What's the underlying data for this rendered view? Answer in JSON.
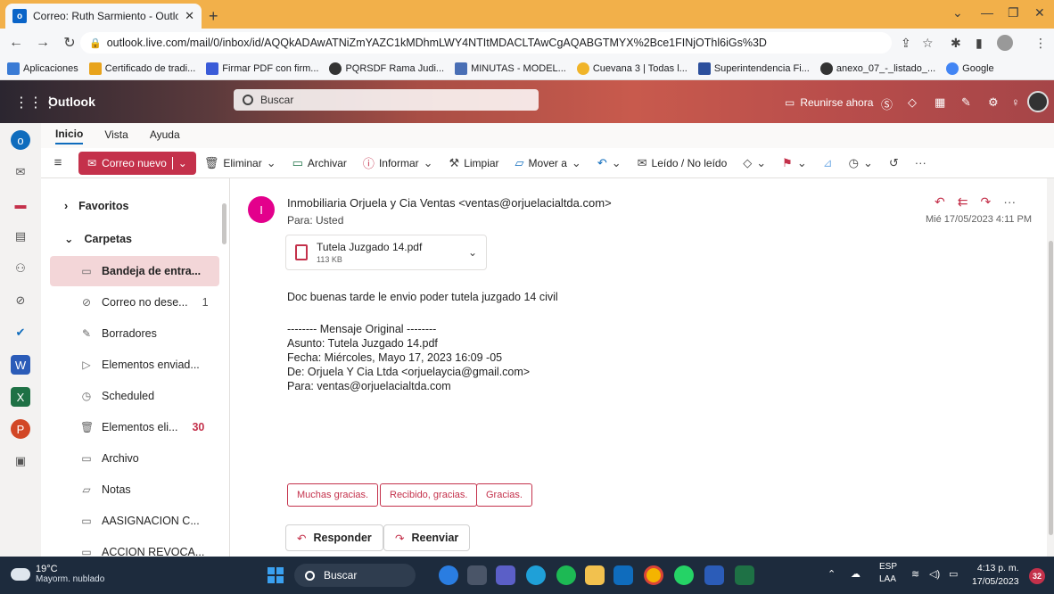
{
  "browser": {
    "tab_title": "Correo: Ruth Sarmiento - Outloo",
    "favicon_letter": "o",
    "url": "outlook.live.com/mail/0/inbox/id/AQQkADAwATNiZmYAZC1kMDhmLWY4NTItMDACLTAwCgAQABGTMYX%2Bce1FINjOThl6iGs%3D"
  },
  "bookmarks": [
    {
      "label": "Aplicaciones",
      "color": "#3a7bd5"
    },
    {
      "label": "Certificado de tradi...",
      "color": "#e8a31c"
    },
    {
      "label": "Firmar PDF con firm...",
      "color": "#3a5bd8"
    },
    {
      "label": "PQRSDF Rama Judi...",
      "color": "#333333"
    },
    {
      "label": "MINUTAS - MODEL...",
      "color": "#4a6fb5"
    },
    {
      "label": "Cuevana 3 | Todas l...",
      "color": "#f0b429"
    },
    {
      "label": "Superintendencia Fi...",
      "color": "#2c4f9c"
    },
    {
      "label": "anexo_07_-_listado_...",
      "color": "#333333"
    },
    {
      "label": "Google",
      "color": "#4285f4"
    }
  ],
  "outlook": {
    "brand": "Outlook",
    "search_placeholder": "Buscar",
    "meet_now": "Reunirse ahora"
  },
  "ribbon": {
    "tabs": [
      "Inicio",
      "Vista",
      "Ayuda"
    ],
    "new_mail": "Correo nuevo",
    "buttons": [
      "Eliminar",
      "Archivar",
      "Informar",
      "Limpiar",
      "Mover a",
      "Leído / No leído"
    ]
  },
  "folders": {
    "favorites": "Favoritos",
    "folders_header": "Carpetas",
    "items": [
      {
        "label": "Bandeja de entra...",
        "count": ""
      },
      {
        "label": "Correo no dese...",
        "count": "1"
      },
      {
        "label": "Borradores",
        "count": ""
      },
      {
        "label": "Elementos enviad...",
        "count": ""
      },
      {
        "label": "Scheduled",
        "count": ""
      },
      {
        "label": "Elementos eli...",
        "count": "30"
      },
      {
        "label": "Archivo",
        "count": ""
      },
      {
        "label": "Notas",
        "count": ""
      },
      {
        "label": "AASIGNACION C...",
        "count": ""
      },
      {
        "label": "ACCION REVOCA...",
        "count": ""
      }
    ]
  },
  "message": {
    "avatar_letter": "I",
    "sender": "Inmobiliaria Orjuela y Cia Ventas <ventas@orjuelacialtda.com>",
    "to": "Para: Usted",
    "date": "Mié 17/05/2023 4:11 PM",
    "attachment_name": "Tutela Juzgado 14.pdf",
    "attachment_size": "113 KB",
    "body_main": "Doc buenas tarde le envio poder tutela juzgado 14 civil",
    "original_header": "-------- Mensaje Original --------",
    "subject_line": "Asunto: Tutela Juzgado 14.pdf",
    "date_line": "Fecha: Miércoles, Mayo 17, 2023 16:09 -05",
    "from_line": "De: Orjuela Y Cia Ltda <orjuelaycia@gmail.com>",
    "to_line": "Para: ventas@orjuelacialtda.com",
    "quick_replies": [
      "Muchas gracias.",
      "Recibido, gracias.",
      "Gracias."
    ],
    "reply": "Responder",
    "forward": "Reenviar"
  },
  "taskbar": {
    "temperature": "19°C",
    "weather": "Mayorm. nublado",
    "search": "Buscar",
    "lang_top": "ESP",
    "lang_bottom": "LAA",
    "time": "4:13 p. m.",
    "date": "17/05/2023",
    "notifications": "32"
  },
  "colors": {
    "accent": "#c4314b",
    "browser_frame": "#f2b04a"
  }
}
